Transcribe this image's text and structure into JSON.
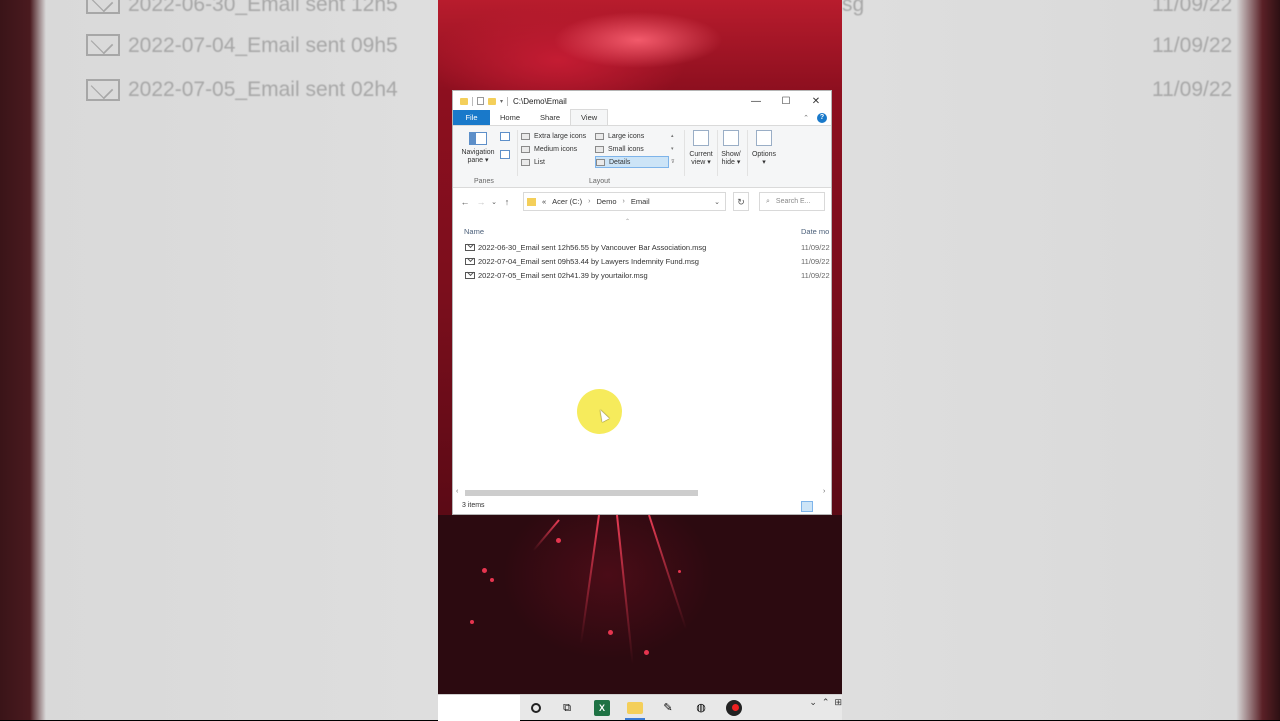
{
  "background_ghost": {
    "rows": [
      {
        "name": "2022-06-30_Email sent 12h5",
        "tail": "sg",
        "date": "11/09/22"
      },
      {
        "name": "2022-07-04_Email sent 09h5",
        "tail": "",
        "date": "11/09/22"
      },
      {
        "name": "2022-07-05_Email sent 02h4",
        "tail": "",
        "date": "11/09/22"
      }
    ]
  },
  "window": {
    "title": "C:\\Demo\\Email",
    "minimize": "—",
    "maximize": "☐",
    "close": "✕"
  },
  "ribbon_tabs": [
    "File",
    "Home",
    "Share",
    "View"
  ],
  "active_tab": "View",
  "help_label": "?",
  "ribbon": {
    "panes": {
      "nav_pane_label_1": "Navigation",
      "nav_pane_label_2": "pane ▾",
      "group_label": "Panes"
    },
    "layout": {
      "items": [
        "Extra large icons",
        "Large icons",
        "Medium icons",
        "Small icons",
        "List",
        "Details"
      ],
      "selected": "Details",
      "group_label": "Layout"
    },
    "current_view": {
      "line1": "Current",
      "line2": "view ▾"
    },
    "show_hide": {
      "line1": "Show/",
      "line2": "hide ▾"
    },
    "options": {
      "line1": "Options",
      "line2": "▾"
    }
  },
  "address": {
    "back": "←",
    "forward": "→",
    "recent": "⌄",
    "up": "↑",
    "prefix": "«",
    "crumbs": [
      "Acer (C:)",
      "Demo",
      "Email"
    ],
    "search_placeholder": "Search E..."
  },
  "columns": {
    "name": "Name",
    "date": "Date mo"
  },
  "files": [
    {
      "name": "2022-06-30_Email sent 12h56.55 by Vancouver Bar Association.msg",
      "date": "11/09/22"
    },
    {
      "name": "2022-07-04_Email sent 09h53.44 by Lawyers Indemnity Fund.msg",
      "date": "11/09/22"
    },
    {
      "name": "2022-07-05_Email sent 02h41.39 by yourtailor.msg",
      "date": "11/09/22"
    }
  ],
  "status": {
    "items_count": "3 items"
  },
  "taskbar": {
    "excel_letter": "X",
    "tray": [
      "⌄",
      "⌃",
      "⊞"
    ]
  },
  "colors": {
    "accent": "#1979ca",
    "selection": "#cce4f7",
    "folder": "#f4cf5a",
    "highlight_halo": "#f5e94a"
  }
}
